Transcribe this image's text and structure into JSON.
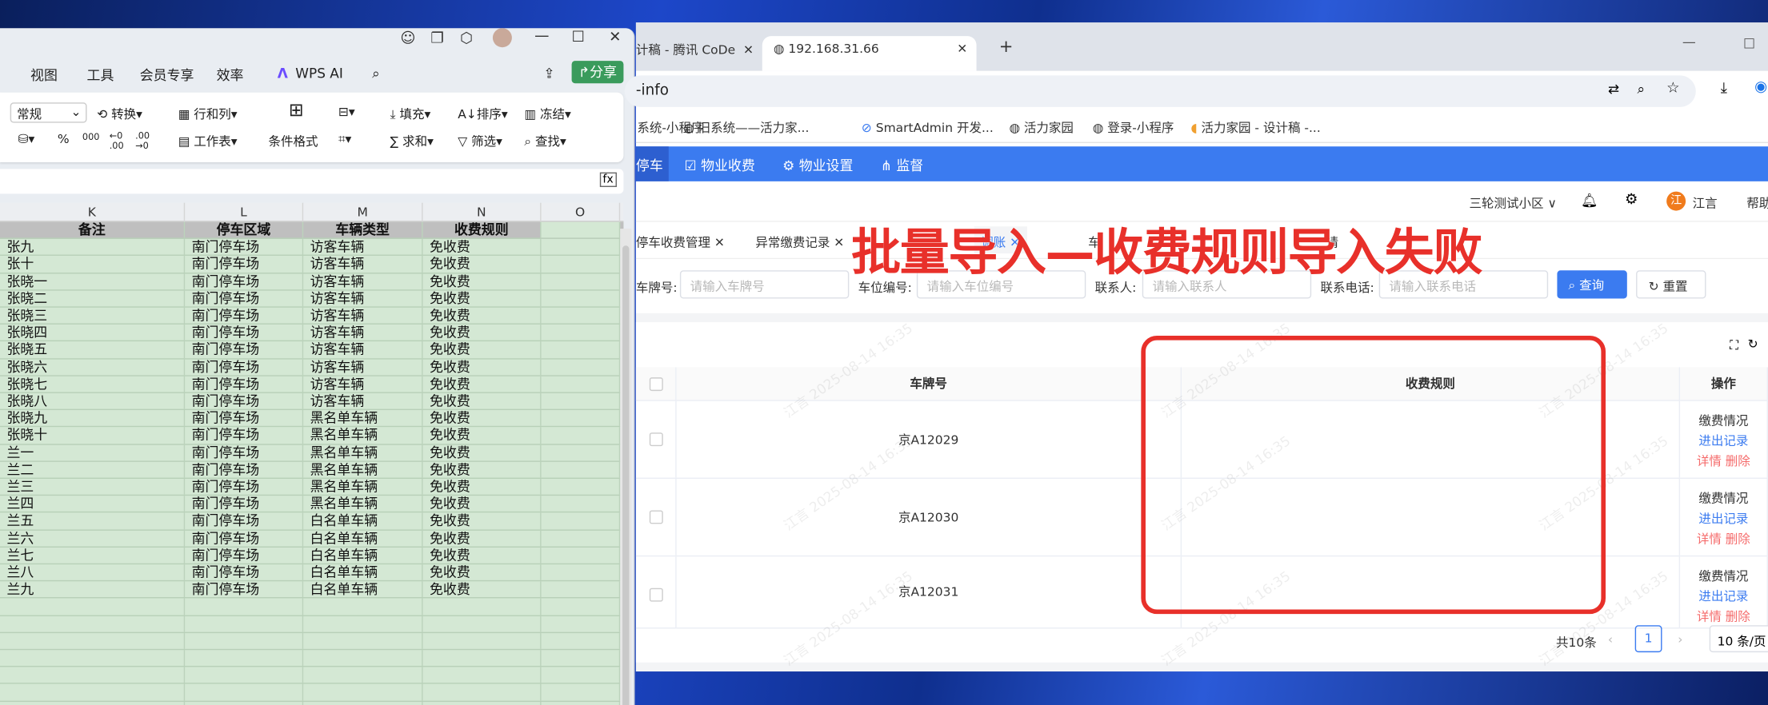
{
  "wps": {
    "menu": [
      "视图",
      "工具",
      "会员专享",
      "效率"
    ],
    "wps_ai": "WPS AI",
    "share": "分享",
    "ribbon": {
      "format": "常规",
      "convert": "转换",
      "rows_cols": "行和列",
      "worksheet": "工作表",
      "cond_format": "条件格式",
      "fill": "填充",
      "sort": "排序",
      "freeze": "冻结",
      "sum": "求和",
      "filter": "筛选",
      "find": "查找",
      "percent": "%",
      "thousands": "000"
    },
    "fx": "fx",
    "columns": [
      "K",
      "L",
      "M",
      "N",
      "O"
    ],
    "headers": [
      "备注",
      "停车区域",
      "车辆类型",
      "收费规则"
    ],
    "rows": [
      [
        "张九",
        "南门停车场",
        "访客车辆",
        "免收费"
      ],
      [
        "张十",
        "南门停车场",
        "访客车辆",
        "免收费"
      ],
      [
        "张晓一",
        "南门停车场",
        "访客车辆",
        "免收费"
      ],
      [
        "张晓二",
        "南门停车场",
        "访客车辆",
        "免收费"
      ],
      [
        "张晓三",
        "南门停车场",
        "访客车辆",
        "免收费"
      ],
      [
        "张晓四",
        "南门停车场",
        "访客车辆",
        "免收费"
      ],
      [
        "张晓五",
        "南门停车场",
        "访客车辆",
        "免收费"
      ],
      [
        "张晓六",
        "南门停车场",
        "访客车辆",
        "免收费"
      ],
      [
        "张晓七",
        "南门停车场",
        "访客车辆",
        "免收费"
      ],
      [
        "张晓八",
        "南门停车场",
        "访客车辆",
        "免收费"
      ],
      [
        "张晓九",
        "南门停车场",
        "黑名单车辆",
        "免收费"
      ],
      [
        "张晓十",
        "南门停车场",
        "黑名单车辆",
        "免收费"
      ],
      [
        "兰一",
        "南门停车场",
        "黑名单车辆",
        "免收费"
      ],
      [
        "兰二",
        "南门停车场",
        "黑名单车辆",
        "免收费"
      ],
      [
        "兰三",
        "南门停车场",
        "黑名单车辆",
        "免收费"
      ],
      [
        "兰四",
        "南门停车场",
        "黑名单车辆",
        "免收费"
      ],
      [
        "兰五",
        "南门停车场",
        "白名单车辆",
        "免收费"
      ],
      [
        "兰六",
        "南门停车场",
        "白名单车辆",
        "免收费"
      ],
      [
        "兰七",
        "南门停车场",
        "白名单车辆",
        "免收费"
      ],
      [
        "兰八",
        "南门停车场",
        "白名单车辆",
        "免收费"
      ],
      [
        "兰九",
        "南门停车场",
        "白名单车辆",
        "免收费"
      ]
    ]
  },
  "browser": {
    "tabs": [
      {
        "title": "计稿 - 腾讯 CoDe"
      },
      {
        "title": "192.168.31.66"
      }
    ],
    "url": "-info",
    "bookmarks": [
      "系统-小程序",
      "旧系统——活力家...",
      "SmartAdmin 开发...",
      "活力家园",
      "登录-小程序",
      "活力家园 - 设计稿 -..."
    ]
  },
  "app": {
    "nav": [
      "停车",
      "物业收费",
      "物业设置",
      "监督"
    ],
    "community": "三轮测试小区",
    "user": "江言",
    "avatar": "江",
    "help": "帮助",
    "tabs": [
      "停车收费管理",
      "异常缴费记录",
      "调账",
      "车",
      "请"
    ],
    "form": {
      "plate_label": "车牌号:",
      "plate_ph": "请输入车牌号",
      "space_label": "车位编号:",
      "space_ph": "请输入车位编号",
      "contact_label": "联系人:",
      "contact_ph": "请输入联系人",
      "phone_label": "联系电话:",
      "phone_ph": "请输入联系电话",
      "search": "查询",
      "reset": "重置"
    },
    "table": {
      "headers": [
        "车牌号",
        "收费规则",
        "操作"
      ],
      "rows": [
        {
          "plate": "京A12029",
          "rule": "",
          "a1": "缴费情况",
          "a2": "进出记录",
          "a3": "详情",
          "a4": "删除"
        },
        {
          "plate": "京A12030",
          "rule": "",
          "a1": "缴费情况",
          "a2": "进出记录",
          "a3": "详情",
          "a4": "删除"
        },
        {
          "plate": "京A12031",
          "rule": "",
          "a1": "缴费情况",
          "a2": "进出记录",
          "a3": "详情",
          "a4": "删除"
        }
      ]
    },
    "pagination": {
      "total": "共10条",
      "page": "1",
      "size": "10 条/页"
    },
    "watermark": "江言 2025-08-14 16:35"
  },
  "annotation": "批量导入—收费规则导入失败",
  "colors": {
    "accent": "#3b7bf0",
    "annotation": "#e8302a",
    "sheet_bg": "#d4e8d4"
  }
}
